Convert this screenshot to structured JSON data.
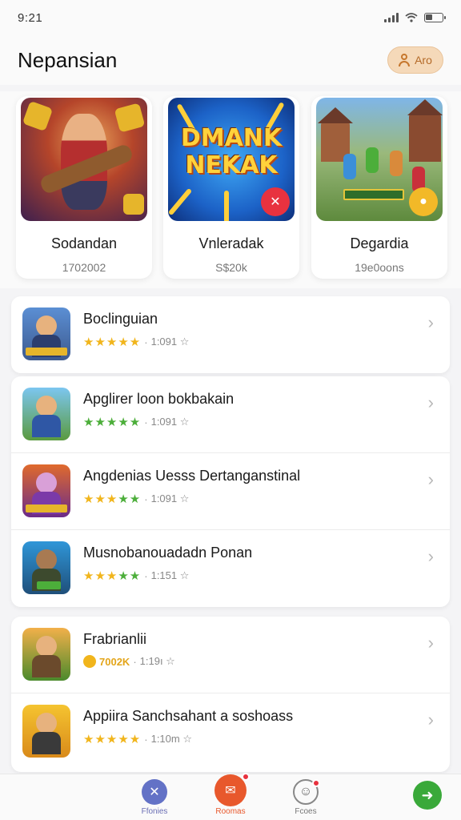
{
  "status_bar": {
    "time": "9:21"
  },
  "header": {
    "title": "Nepansian",
    "profile_label": "Aro"
  },
  "featured": [
    {
      "title": "Sodandan",
      "subtitle": "1702002",
      "art_text": "",
      "badge": ""
    },
    {
      "title": "Vnleradak",
      "subtitle": "S$20k",
      "art_text": "DMANK NEKAK",
      "badge": "✕"
    },
    {
      "title": "Degardia",
      "subtitle": "19e0oons",
      "art_text": "",
      "badge": "●"
    }
  ],
  "list_groups": [
    {
      "rows": [
        {
          "title": "Boclinguian",
          "rating_text": "1:091 ☆",
          "stars": "yellow"
        }
      ]
    },
    {
      "rows": [
        {
          "title": "Apglirer loon bokbakain",
          "rating_text": "1:091 ☆",
          "stars": "green"
        },
        {
          "title": "Angdenias Uesss Dertanganstinal",
          "rating_text": "1:091 ☆",
          "stars": "mixed"
        },
        {
          "title": "Musnobanouadadn Ponan",
          "rating_text": "1:151 ☆",
          "stars": "mixed"
        }
      ]
    },
    {
      "rows": [
        {
          "title": "Frabrianlii",
          "rating_text": "1:19ı ☆",
          "stars": "coin",
          "alt_text": "7002K"
        },
        {
          "title": "Appiira Sanchsahant a soshoass",
          "rating_text": "1:10m ☆",
          "stars": "yellow"
        }
      ]
    }
  ],
  "bottom_nav": [
    {
      "label": "Ffonies",
      "icon": "games-icon"
    },
    {
      "label": "Roomas",
      "icon": "chat-icon"
    },
    {
      "label": "Fcoes",
      "icon": "profile-icon"
    }
  ],
  "colors": {
    "accent": "#e8582c",
    "primary": "#6372c6",
    "star_yellow": "#f1b51c",
    "star_green": "#4cae3a",
    "fab": "#3aa93a"
  }
}
